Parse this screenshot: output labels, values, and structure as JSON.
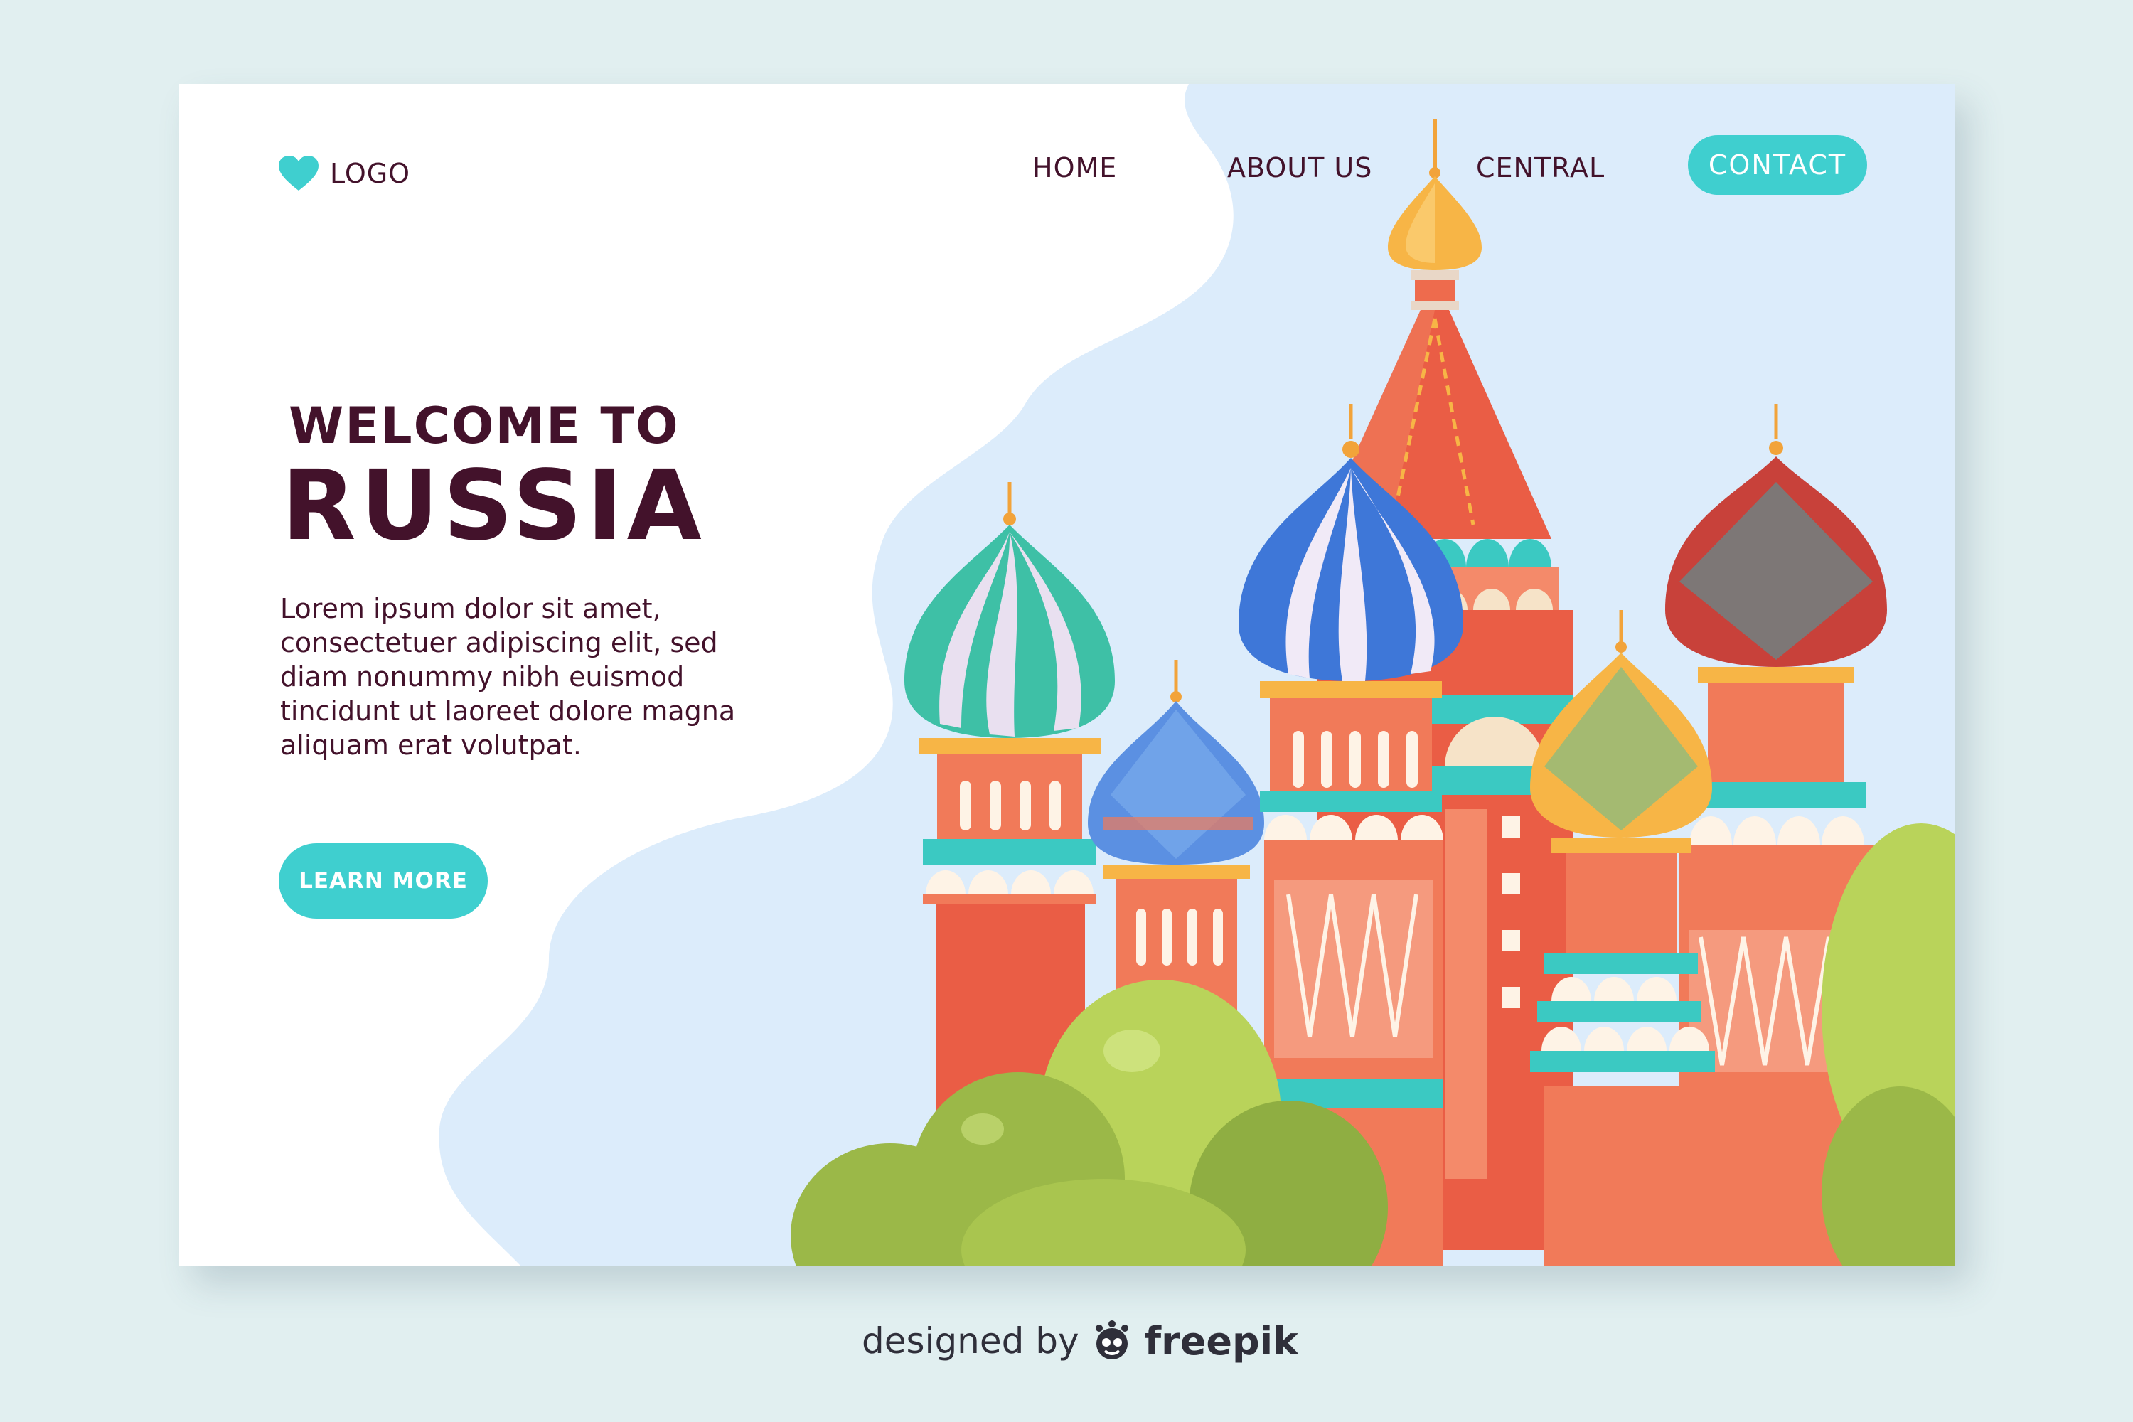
{
  "header": {
    "logo_label": "LOGO",
    "nav": [
      {
        "label": "HOME"
      },
      {
        "label": "ABOUT US"
      },
      {
        "label": "CENTRAL"
      },
      {
        "label": "CONTACT"
      }
    ]
  },
  "hero": {
    "title_line1": "WELCOME TO",
    "title_line2": "RUSSIA",
    "body": "Lorem ipsum dolor sit amet, consectetuer adipiscing elit, sed diam nonummy nibh euismod tincidunt ut laoreet dolore magna aliquam erat volutpat.",
    "cta_label": "LEARN MORE"
  },
  "footer": {
    "prefix": "designed by",
    "brand": "freepik"
  },
  "colors": {
    "accent": "#3fcfcf",
    "text": "#43122b",
    "page_bg": "#e1eff0",
    "sky": "#dcecfb"
  },
  "icons": {
    "logo": "heart-icon",
    "brand": "freepik-mascot-icon"
  }
}
